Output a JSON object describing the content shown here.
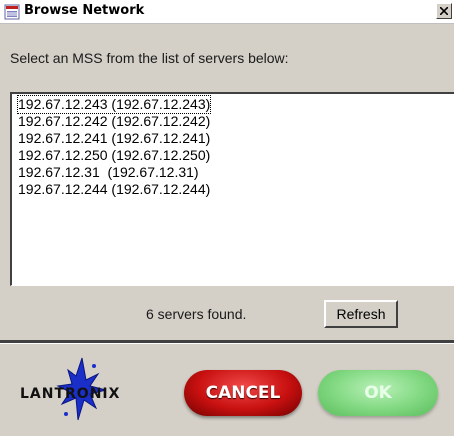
{
  "window": {
    "title": "Browse Network",
    "close_label": "×"
  },
  "prompt": "Select an MSS from the list of servers below:",
  "servers": [
    "192.67.12.243 (192.67.12.243)",
    "192.67.12.242 (192.67.12.242)",
    "192.67.12.241 (192.67.12.241)",
    "192.67.12.250 (192.67.12.250)",
    "192.67.12.31  (192.67.12.31)",
    "192.67.12.244 (192.67.12.244)"
  ],
  "status": "6 servers found.",
  "buttons": {
    "refresh": "Refresh",
    "cancel": "CANCEL",
    "ok": "OK"
  },
  "logo": {
    "text": "LANTRONIX"
  },
  "colors": {
    "cancel": "#c81010",
    "ok": "#80d880",
    "background": "#d4d0c8"
  },
  "icons": {
    "title": "app-icon",
    "close": "close-icon",
    "logo": "lantronix-logo"
  }
}
